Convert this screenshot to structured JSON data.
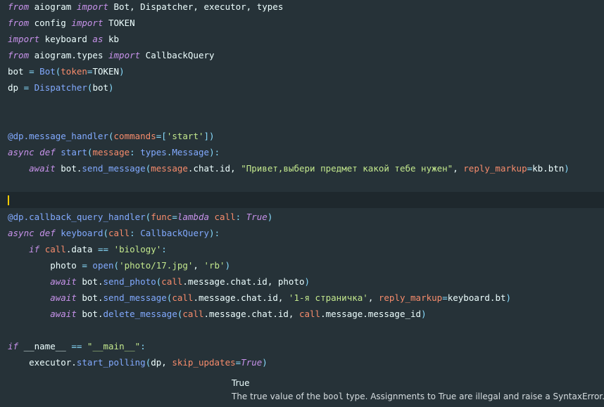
{
  "editor": {
    "theme_colors": {
      "background": "#263238",
      "current_line": "#1e282d",
      "cursor": "#ffcc00",
      "keyword": "#c792ea",
      "function": "#82aaff",
      "parameter": "#f78c6c",
      "operator": "#89ddff",
      "string": "#c3e88d",
      "identifier": "#eeffff"
    },
    "lines": [
      [
        [
          "kw",
          "from"
        ],
        [
          "id",
          " aiogram "
        ],
        [
          "kw",
          "import"
        ],
        [
          "id",
          " Bot, Dispatcher, executor, types"
        ]
      ],
      [
        [
          "kw",
          "from"
        ],
        [
          "id",
          " config "
        ],
        [
          "kw",
          "import"
        ],
        [
          "id",
          " TOKEN"
        ]
      ],
      [
        [
          "kw",
          "import"
        ],
        [
          "id",
          " keyboard "
        ],
        [
          "kw",
          "as"
        ],
        [
          "id",
          " kb"
        ]
      ],
      [
        [
          "kw",
          "from"
        ],
        [
          "id",
          " aiogram.types "
        ],
        [
          "kw",
          "import"
        ],
        [
          "id",
          " CallbackQuery"
        ]
      ],
      [
        [
          "id",
          "bot "
        ],
        [
          "op",
          "="
        ],
        [
          "id",
          " "
        ],
        [
          "cls",
          "Bot"
        ],
        [
          "punct",
          "("
        ],
        [
          "param",
          "token"
        ],
        [
          "op",
          "="
        ],
        [
          "id",
          "TOKEN"
        ],
        [
          "punct",
          ")"
        ]
      ],
      [
        [
          "id",
          "dp "
        ],
        [
          "op",
          "="
        ],
        [
          "id",
          " "
        ],
        [
          "cls",
          "Dispatcher"
        ],
        [
          "punct",
          "("
        ],
        [
          "id",
          "bot"
        ],
        [
          "punct",
          ")"
        ]
      ],
      [],
      [],
      [
        [
          "dec",
          "@dp.message_handler"
        ],
        [
          "punct",
          "("
        ],
        [
          "param",
          "commands"
        ],
        [
          "op",
          "="
        ],
        [
          "punct",
          "["
        ],
        [
          "str",
          "'start'"
        ],
        [
          "punct",
          "])"
        ]
      ],
      [
        [
          "kw",
          "async"
        ],
        [
          "id",
          " "
        ],
        [
          "kw",
          "def"
        ],
        [
          "id",
          " "
        ],
        [
          "fn",
          "start"
        ],
        [
          "punct",
          "("
        ],
        [
          "param",
          "message"
        ],
        [
          "punct",
          ": "
        ],
        [
          "cls",
          "types"
        ],
        [
          "punct",
          "."
        ],
        [
          "cls",
          "Message"
        ],
        [
          "punct",
          "):"
        ]
      ],
      [
        [
          "id",
          "    "
        ],
        [
          "kw",
          "await"
        ],
        [
          "id",
          " bot."
        ],
        [
          "fn",
          "send_message"
        ],
        [
          "punct",
          "("
        ],
        [
          "param",
          "message"
        ],
        [
          "id",
          ".chat.id, "
        ],
        [
          "str",
          "\"Привет,выбери предмет какой тебе нужен\""
        ],
        [
          "id",
          ", "
        ],
        [
          "param",
          "reply_markup"
        ],
        [
          "op",
          "="
        ],
        [
          "id",
          "kb.btn"
        ],
        [
          "punct",
          ")"
        ]
      ],
      [],
      [],
      [
        [
          "dec",
          "@dp.callback_query_handler"
        ],
        [
          "punct",
          "("
        ],
        [
          "param",
          "func"
        ],
        [
          "op",
          "="
        ],
        [
          "kw",
          "lambda"
        ],
        [
          "id",
          " "
        ],
        [
          "param",
          "call"
        ],
        [
          "punct",
          ": "
        ],
        [
          "const",
          "True"
        ],
        [
          "punct",
          ")"
        ]
      ],
      [
        [
          "kw",
          "async"
        ],
        [
          "id",
          " "
        ],
        [
          "kw",
          "def"
        ],
        [
          "id",
          " "
        ],
        [
          "fn",
          "keyboard"
        ],
        [
          "punct",
          "("
        ],
        [
          "param",
          "call"
        ],
        [
          "punct",
          ": "
        ],
        [
          "cls",
          "CallbackQuery"
        ],
        [
          "punct",
          "):"
        ]
      ],
      [
        [
          "id",
          "    "
        ],
        [
          "kw",
          "if"
        ],
        [
          "id",
          " "
        ],
        [
          "param",
          "call"
        ],
        [
          "id",
          ".data "
        ],
        [
          "op",
          "=="
        ],
        [
          "id",
          " "
        ],
        [
          "str",
          "'biology'"
        ],
        [
          "punct",
          ":"
        ]
      ],
      [
        [
          "id",
          "        photo "
        ],
        [
          "op",
          "="
        ],
        [
          "id",
          " "
        ],
        [
          "fn",
          "open"
        ],
        [
          "punct",
          "("
        ],
        [
          "str",
          "'photo/17.jpg'"
        ],
        [
          "id",
          ", "
        ],
        [
          "str",
          "'rb'"
        ],
        [
          "punct",
          ")"
        ]
      ],
      [
        [
          "id",
          "        "
        ],
        [
          "kw",
          "await"
        ],
        [
          "id",
          " bot."
        ],
        [
          "fn",
          "send_photo"
        ],
        [
          "punct",
          "("
        ],
        [
          "param",
          "call"
        ],
        [
          "id",
          ".message.chat.id, photo"
        ],
        [
          "punct",
          ")"
        ]
      ],
      [
        [
          "id",
          "        "
        ],
        [
          "kw",
          "await"
        ],
        [
          "id",
          " bot."
        ],
        [
          "fn",
          "send_message"
        ],
        [
          "punct",
          "("
        ],
        [
          "param",
          "call"
        ],
        [
          "id",
          ".message.chat.id, "
        ],
        [
          "str",
          "'1-я страничка'"
        ],
        [
          "id",
          ", "
        ],
        [
          "param",
          "reply_markup"
        ],
        [
          "op",
          "="
        ],
        [
          "id",
          "keyboard.bt"
        ],
        [
          "punct",
          ")"
        ]
      ],
      [
        [
          "id",
          "        "
        ],
        [
          "kw",
          "await"
        ],
        [
          "id",
          " bot."
        ],
        [
          "fn",
          "delete_message"
        ],
        [
          "punct",
          "("
        ],
        [
          "param",
          "call"
        ],
        [
          "id",
          ".message.chat.id, "
        ],
        [
          "param",
          "call"
        ],
        [
          "id",
          ".message.message_id"
        ],
        [
          "punct",
          ")"
        ]
      ],
      [],
      [
        [
          "kw",
          "if"
        ],
        [
          "id",
          " __name__ "
        ],
        [
          "op",
          "=="
        ],
        [
          "id",
          " "
        ],
        [
          "str",
          "\"__main__\""
        ],
        [
          "punct",
          ":"
        ]
      ],
      [
        [
          "id",
          "    executor."
        ],
        [
          "fn",
          "start_polling"
        ],
        [
          "punct",
          "("
        ],
        [
          "id",
          "dp, "
        ],
        [
          "param",
          "skip_updates"
        ],
        [
          "op",
          "="
        ],
        [
          "const",
          "True"
        ],
        [
          "punct",
          ")"
        ]
      ]
    ]
  },
  "tooltip": {
    "title": "True",
    "body_pre": "The true value of the ",
    "body_code": "bool",
    "body_mid": " type. Assignments to ",
    "body_code2": "True",
    "body_post": " are illegal and raise a SyntaxError."
  }
}
